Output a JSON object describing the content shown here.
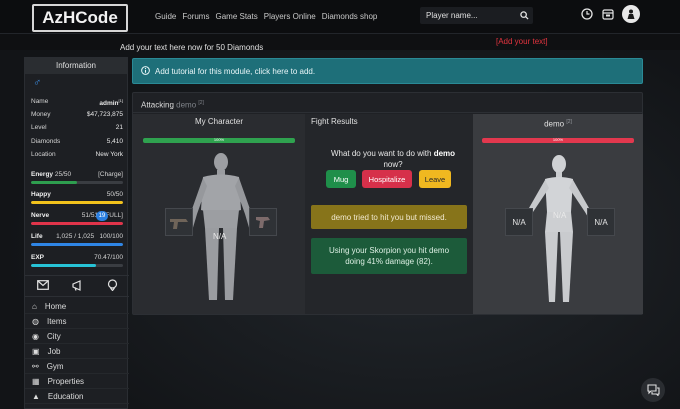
{
  "header": {
    "logo": "AzHCode",
    "nav": [
      "Guide",
      "Forums",
      "Game Stats",
      "Players Online",
      "Diamonds shop"
    ],
    "search_placeholder": "Player name...",
    "icons": [
      "clock-icon",
      "calendar-icon",
      "avatar-icon"
    ]
  },
  "promo": {
    "text": "Add your text here now for 50 Diamonds",
    "link": "[Add your text]"
  },
  "sidebar": {
    "title": "Information",
    "info": [
      {
        "label": "Name",
        "value": "admin",
        "sup": "[1]"
      },
      {
        "label": "Money",
        "value": "$47,723,875"
      },
      {
        "label": "Level",
        "value": "21"
      },
      {
        "label": "Diamonds",
        "value": "5,410"
      },
      {
        "label": "Location",
        "value": "New York"
      }
    ],
    "bars": [
      {
        "label": "Energy",
        "value": "25/50",
        "extra": "[Charge]",
        "fill": 0.5,
        "color": "#2e9e4f"
      },
      {
        "label": "Happy",
        "value": "50/50",
        "extra": "",
        "fill": 1.0,
        "color": "#f2c21c"
      },
      {
        "label": "Nerve",
        "value": "51/51",
        "extra": "[FULL]",
        "fill": 1.0,
        "color": "#e0344a"
      },
      {
        "label": "Life",
        "value": "1,025 / 1,025",
        "extra": "100/100",
        "fill": 1.0,
        "color": "#2f86e6"
      },
      {
        "label": "EXP",
        "value": "70.47/100",
        "extra": "",
        "fill": 0.7047,
        "color": "#27c3d6"
      }
    ],
    "badge": "19",
    "menu": [
      "Home",
      "Items",
      "City",
      "Job",
      "Gym",
      "Properties",
      "Education"
    ]
  },
  "main": {
    "tutorial": "Add tutorial for this module, click here to add.",
    "panel_title": "Attacking",
    "panel_target": "demo",
    "panel_sup": "[2]",
    "col_left": "My Character",
    "col_mid": "Fight Results",
    "col_right": "demo",
    "col_right_sup": "[2]",
    "hp_left": "100%",
    "hp_right": "100%",
    "na": "N/A",
    "question_pre": "What do you want to do with",
    "question_name": "demo",
    "question_post": "now?",
    "buttons": {
      "mug": "Mug",
      "hospitalize": "Hospitalize",
      "leave": "Leave"
    },
    "msg1": "demo tried to hit you but missed.",
    "msg2": "Using your Skorpion you hit demo doing 41% damage (82)."
  }
}
